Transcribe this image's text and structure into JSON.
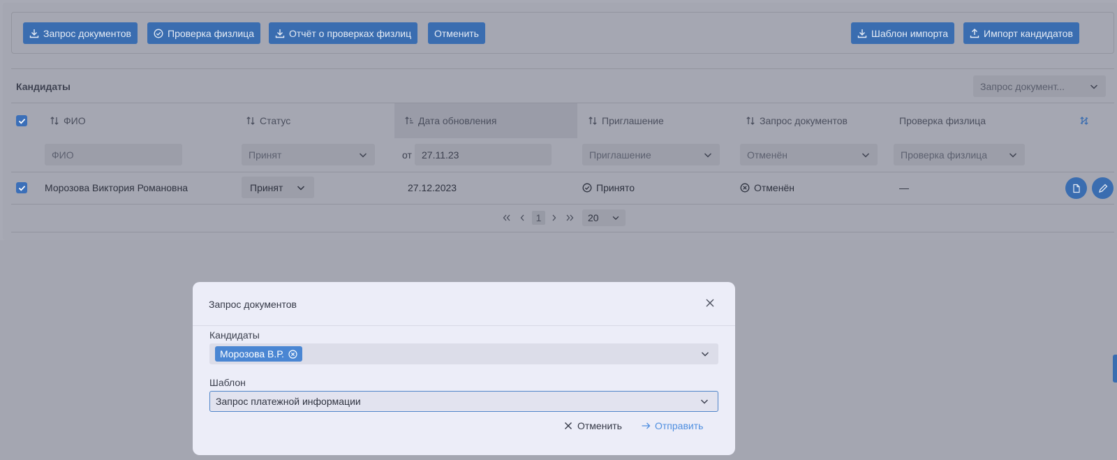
{
  "toolbar": {
    "btn_request_docs": "Запрос документов",
    "btn_check_person": "Проверка физлица",
    "btn_report": "Отчёт о проверках физлиц",
    "btn_cancel": "Отменить",
    "btn_import_template": "Шаблон импорта",
    "btn_import_candidates": "Импорт кандидатов"
  },
  "table": {
    "title": "Кандидаты",
    "view_select": "Запрос документ...",
    "headers": {
      "fio": "ФИО",
      "status": "Статус",
      "updated": "Дата обновления",
      "invite": "Приглашение",
      "docs": "Запрос документов",
      "check": "Проверка физлица"
    },
    "filters": {
      "fio_placeholder": "ФИО",
      "status": "Принят",
      "date_prefix": "от",
      "date_value": "27.11.23",
      "invite": "Приглашение",
      "docs": "Отменён",
      "check": "Проверка физлица"
    },
    "rows": [
      {
        "fio": "Морозова Виктория Романовна",
        "status": "Принят",
        "updated": "27.12.2023",
        "invite": "Принято",
        "docs": "Отменён",
        "check": "—"
      }
    ],
    "pager": {
      "current_page": "1",
      "page_size": "20"
    }
  },
  "modal": {
    "title": "Запрос документов",
    "candidates_label": "Кандидаты",
    "candidate_chip": "Морозова В.Р.",
    "template_label": "Шаблон",
    "template_value": "Запрос платежной информации",
    "cancel_label": "Отменить",
    "submit_label": "Отправить"
  },
  "colors": {
    "accent": "#3a6db0",
    "chip": "#4a86d3",
    "submit": "#4f8fe0"
  }
}
